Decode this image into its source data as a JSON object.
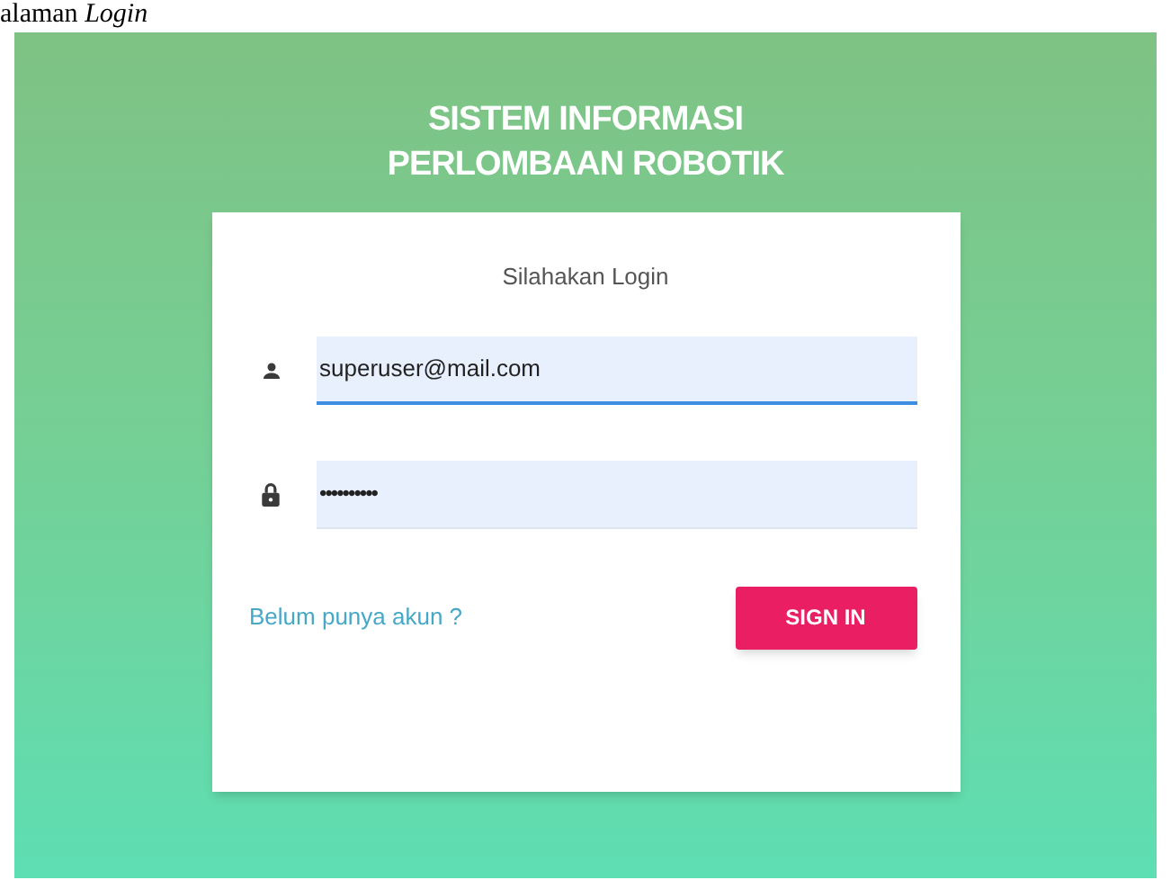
{
  "caption": "alaman *Login*",
  "app_title": [
    "SISTEM INFORMASI",
    "PERLOMBAAN ROBOTIK"
  ],
  "login_card": {
    "heading": "Silahakan Login",
    "fields": [
      {
        "kind": "email",
        "value": "superuser@mail.com",
        "focused": true
      },
      {
        "kind": "password",
        "value": "••••••••••",
        "focused": false
      }
    ],
    "register_link": "Belum punya akun ?",
    "submit_button": "SIGN IN"
  }
}
